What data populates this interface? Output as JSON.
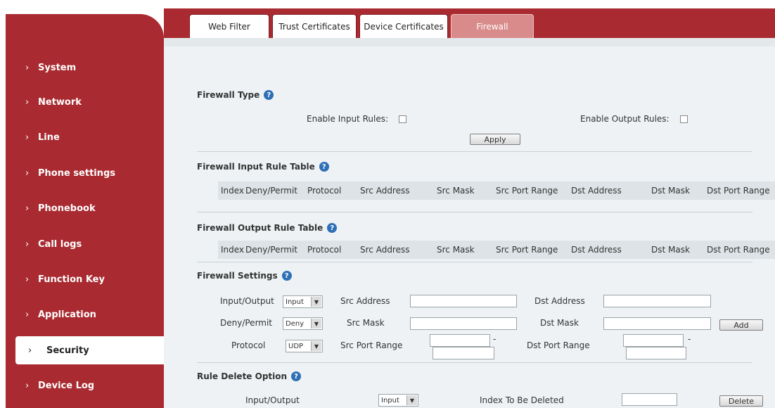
{
  "sidebar": {
    "items": [
      {
        "label": "System"
      },
      {
        "label": "Network"
      },
      {
        "label": "Line"
      },
      {
        "label": "Phone settings"
      },
      {
        "label": "Phonebook"
      },
      {
        "label": "Call logs"
      },
      {
        "label": "Function Key"
      },
      {
        "label": "Application"
      },
      {
        "label": "Security",
        "active": true
      },
      {
        "label": "Device Log"
      }
    ],
    "chevron": "›"
  },
  "tabs": [
    {
      "label": "Web Filter"
    },
    {
      "label": "Trust Certificates"
    },
    {
      "label": "Device Certificates"
    },
    {
      "label": "Firewall",
      "active": true
    }
  ],
  "colors": {
    "brand": "#a92a30",
    "active_tab": "#d98b8b",
    "panel": "#eef2f4",
    "help_icon": "#2f6fb6"
  },
  "firewall_type": {
    "title": "Firewall Type",
    "enable_input_label": "Enable Input Rules:",
    "enable_input_checked": false,
    "enable_output_label": "Enable Output Rules:",
    "enable_output_checked": false,
    "apply_label": "Apply"
  },
  "input_rules": {
    "title": "Firewall Input Rule Table",
    "columns": [
      "Index",
      "Deny/Permit",
      "Protocol",
      "Src Address",
      "Src Mask",
      "Src Port Range",
      "Dst Address",
      "Dst Mask",
      "Dst Port Range"
    ]
  },
  "output_rules": {
    "title": "Firewall Output Rule Table",
    "columns": [
      "Index",
      "Deny/Permit",
      "Protocol",
      "Src Address",
      "Src Mask",
      "Src Port Range",
      "Dst Address",
      "Dst Mask",
      "Dst Port Range"
    ]
  },
  "settings": {
    "title": "Firewall Settings",
    "io_label": "Input/Output",
    "io_value": "Input",
    "deny_label": "Deny/Permit",
    "deny_value": "Deny",
    "protocol_label": "Protocol",
    "protocol_value": "UDP",
    "src_address_label": "Src Address",
    "src_mask_label": "Src Mask",
    "src_port_label": "Src Port Range",
    "dst_address_label": "Dst Address",
    "dst_mask_label": "Dst Mask",
    "dst_port_label": "Dst Port Range",
    "range_sep": "-",
    "add_label": "Add"
  },
  "delete_option": {
    "title": "Rule Delete Option",
    "io_label": "Input/Output",
    "io_value": "Input",
    "index_label": "Index To Be Deleted",
    "delete_label": "Delete"
  },
  "help_glyph": "?",
  "dropdown_glyph": "▼"
}
